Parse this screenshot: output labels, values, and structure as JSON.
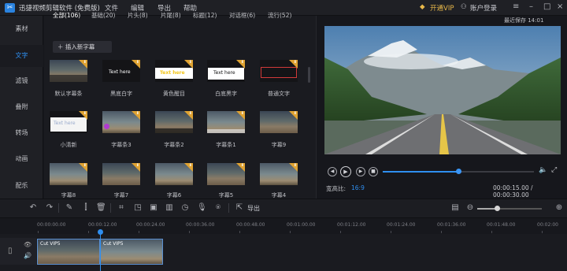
{
  "titlebar": {
    "app_name": "迅捷视频剪辑软件 (免费版)",
    "menus": [
      "文件",
      "编辑",
      "导出",
      "帮助"
    ],
    "vip_label": "开通VIP",
    "login_label": "账户登录"
  },
  "sidebar": {
    "items": [
      {
        "label": "素材"
      },
      {
        "label": "文字"
      },
      {
        "label": "滤镜"
      },
      {
        "label": "叠附"
      },
      {
        "label": "转场"
      },
      {
        "label": "动画"
      },
      {
        "label": "配乐"
      }
    ],
    "active_index": 1
  },
  "library": {
    "filter_tabs": [
      "全部(106)",
      "基础(20)",
      "片头(8)",
      "片尾(8)",
      "标题(12)",
      "对话框(6)",
      "流行(52)"
    ],
    "insert_button": "插入新字幕",
    "tiles": [
      {
        "caption": "默认字幕条",
        "text": ""
      },
      {
        "caption": "黑底白字",
        "text": "Text here"
      },
      {
        "caption": "黄色醒目",
        "text": "Text here"
      },
      {
        "caption": "白底黑字",
        "text": "Text here"
      },
      {
        "caption": "普通文字",
        "text": ""
      },
      {
        "caption": "小清新",
        "text": "Text here"
      },
      {
        "caption": "字幕条3",
        "text": ""
      },
      {
        "caption": "字幕条2",
        "text": ""
      },
      {
        "caption": "字幕条1",
        "text": ""
      },
      {
        "caption": "字幕9",
        "text": ""
      },
      {
        "caption": "字幕8",
        "text": ""
      },
      {
        "caption": "字幕7",
        "text": ""
      },
      {
        "caption": "字幕6",
        "text": ""
      },
      {
        "caption": "字幕5",
        "text": ""
      },
      {
        "caption": "字幕4",
        "text": ""
      }
    ]
  },
  "preview": {
    "save_time": "最近保存 14:01",
    "progress": 0.5,
    "ratio_label": "宽高比:",
    "ratio_value": "16:9",
    "current_time": "00:00:15.00",
    "total_time": "00:00:30.00",
    "time_separator": " / "
  },
  "toolbar": {
    "export_label": "导出"
  },
  "timeline": {
    "ticks": [
      "00:00:00.00",
      "00:00:12.00",
      "00:00:24.00",
      "00:00:36.00",
      "00:00:48.00",
      "00:01:00.00",
      "00:01:12.00",
      "00:01:24.00",
      "00:01:36.00",
      "00:01:48.00",
      "00:02:00"
    ],
    "clips": [
      {
        "label": "Cut VIP5"
      },
      {
        "label": "Cut VIP5"
      }
    ]
  },
  "colors": {
    "accent": "#2f8ff0",
    "vip_gold": "#e8b84a",
    "badge_orange": "#e0a332"
  }
}
